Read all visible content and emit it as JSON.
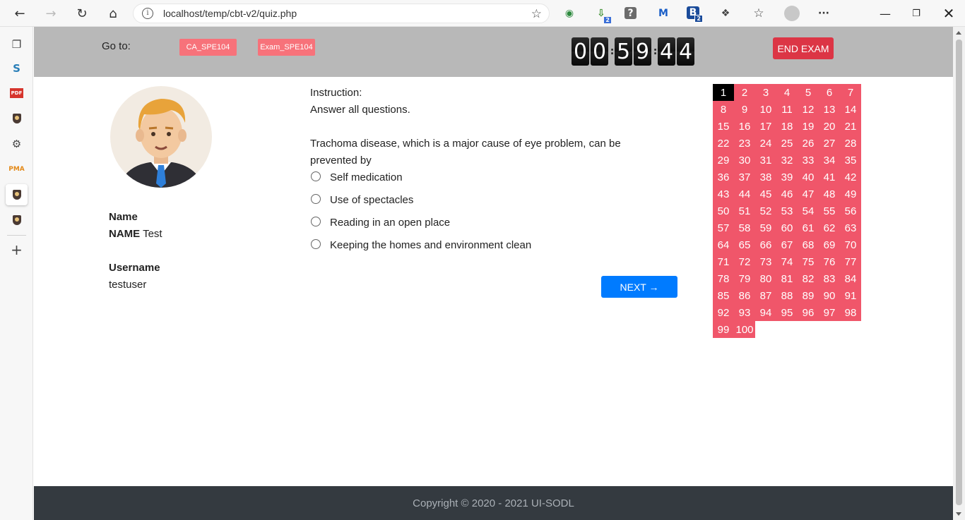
{
  "browser": {
    "url": "localhost/temp/cbt-v2/quiz.php",
    "ext_badge_1": "2",
    "ext_badge_2": "2"
  },
  "header": {
    "goto_label": "Go to:",
    "courses": [
      "CA_SPE104",
      "Exam_SPE104"
    ],
    "timer_digits": [
      "0",
      "0",
      "5",
      "9",
      "4",
      "4"
    ],
    "end_label": "END EXAM"
  },
  "profile": {
    "name_label": "Name",
    "name_prefix": "NAME",
    "name_value": "Test",
    "username_label": "Username",
    "username_value": "testuser"
  },
  "question": {
    "instruction_label": "Instruction:",
    "instruction_text": "Answer all questions.",
    "text": "Trachoma disease, which is a major cause of eye problem, can be prevented by",
    "options": [
      "Self medication",
      "Use of spectacles",
      "Reading in an open place",
      "Keeping the homes and environment clean"
    ],
    "next_label": "NEXT →"
  },
  "navigator": {
    "total": 100,
    "current": 1
  },
  "footer": {
    "copyright": "Copyright © 2020 - 2021 UI-SODL"
  },
  "colors": {
    "header_bg": "#b8b8b8",
    "course_btn": "#f7727a",
    "end_btn": "#dc3545",
    "next_btn": "#007bff",
    "grid_cell": "#f0566a",
    "grid_current": "#000000",
    "footer_bg": "#343a40"
  }
}
